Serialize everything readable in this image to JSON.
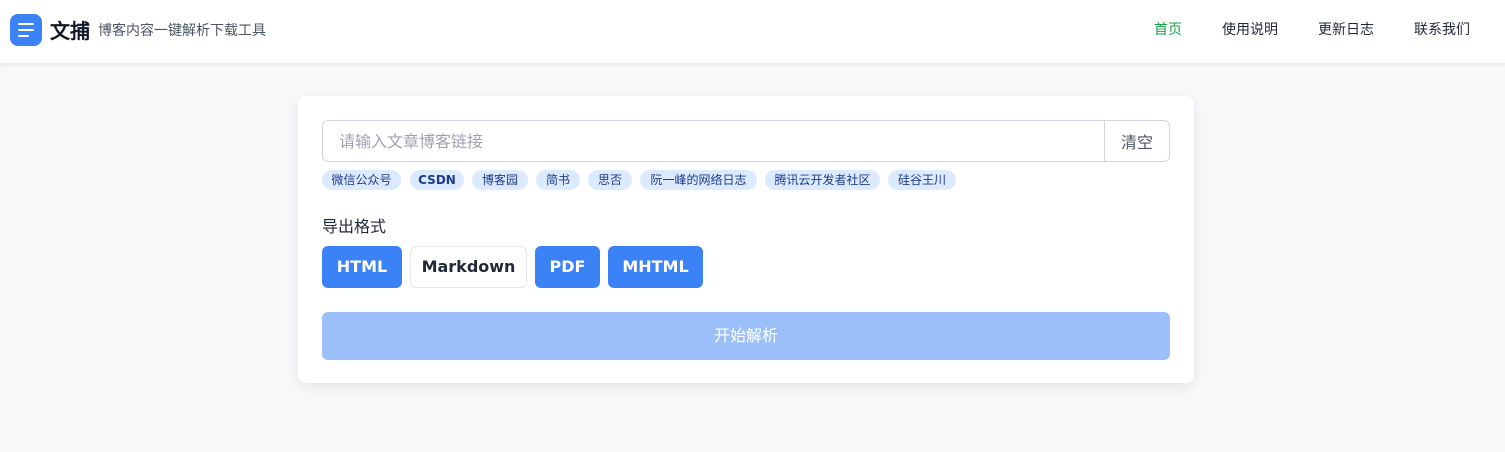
{
  "header": {
    "brand_name": "文捕",
    "brand_subtitle": "博客内容一键解析下载工具",
    "logo_icon": "menu-icon",
    "nav": [
      {
        "label": "首页",
        "active": true
      },
      {
        "label": "使用说明",
        "active": false
      },
      {
        "label": "更新日志",
        "active": false
      },
      {
        "label": "联系我们",
        "active": false
      }
    ]
  },
  "form": {
    "url_input": {
      "value": "",
      "placeholder": "请输入文章博客链接"
    },
    "clear_label": "清空",
    "sources": [
      "微信公众号",
      "CSDN",
      "博客园",
      "简书",
      "思否",
      "阮一峰的网络日志",
      "腾讯云开发者社区",
      "硅谷王川"
    ],
    "format_label": "导出格式",
    "formats": [
      {
        "label": "HTML",
        "selected": true
      },
      {
        "label": "Markdown",
        "selected": false
      },
      {
        "label": "PDF",
        "selected": true
      },
      {
        "label": "MHTML",
        "selected": true
      }
    ],
    "submit_label": "开始解析"
  },
  "colors": {
    "accent": "#3b82f6",
    "nav_active": "#16a34a",
    "tag_bg": "#dbeafe",
    "submit_disabled": "#9bbff8"
  }
}
